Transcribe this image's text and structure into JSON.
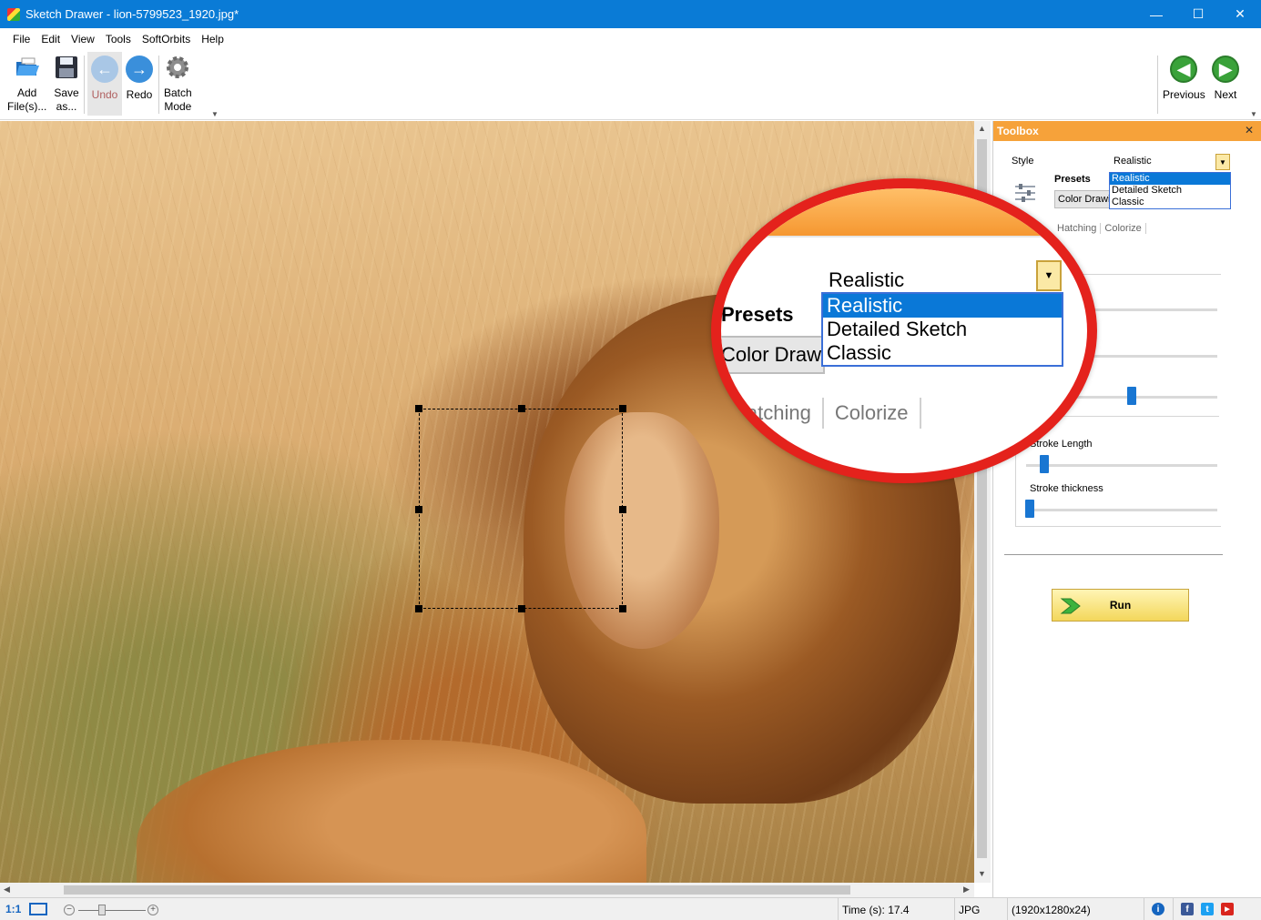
{
  "window": {
    "title": "Sketch Drawer - lion-5799523_1920.jpg*",
    "minimize": "—",
    "maximize": "☐",
    "close": "✕"
  },
  "menu": {
    "file": "File",
    "edit": "Edit",
    "view": "View",
    "tools": "Tools",
    "softorbits": "SoftOrbits",
    "help": "Help"
  },
  "toolbar": {
    "add_line1": "Add",
    "add_line2": "File(s)...",
    "save_line1": "Save",
    "save_line2": "as...",
    "undo": "Undo",
    "redo": "Redo",
    "batch_line1": "Batch",
    "batch_line2": "Mode",
    "previous": "Previous",
    "next": "Next"
  },
  "toolbox": {
    "title": "Toolbox",
    "close": "✕",
    "style_label": "Style",
    "style_value": "Realistic",
    "style_options": [
      "Realistic",
      "Detailed Sketch",
      "Classic"
    ],
    "presets_label": "Presets",
    "preset_value": "Color Drawing",
    "tabs": [
      "Hatching",
      "Colorize"
    ],
    "stroke_length_label": "Stroke Length",
    "stroke_thickness_label": "Stroke thickness",
    "run": "Run"
  },
  "magnifier": {
    "style_value": "Realistic",
    "presets_label": "Presets",
    "preset_value": "Color Drawing",
    "options": [
      "Realistic",
      "Detailed Sketch",
      "Classic"
    ],
    "tabs": [
      "Hatching",
      "Colorize"
    ]
  },
  "status": {
    "zoom_actual": "1:1",
    "time": "Time (s): 17.4",
    "format": "JPG",
    "dimensions": "(1920x1280x24)"
  },
  "colors": {
    "titlebar": "#0a7bd6",
    "toolbox_header": "#f6a23a",
    "magnifier_ring": "#e4221c",
    "selection_highlight": "#0a78d7"
  }
}
